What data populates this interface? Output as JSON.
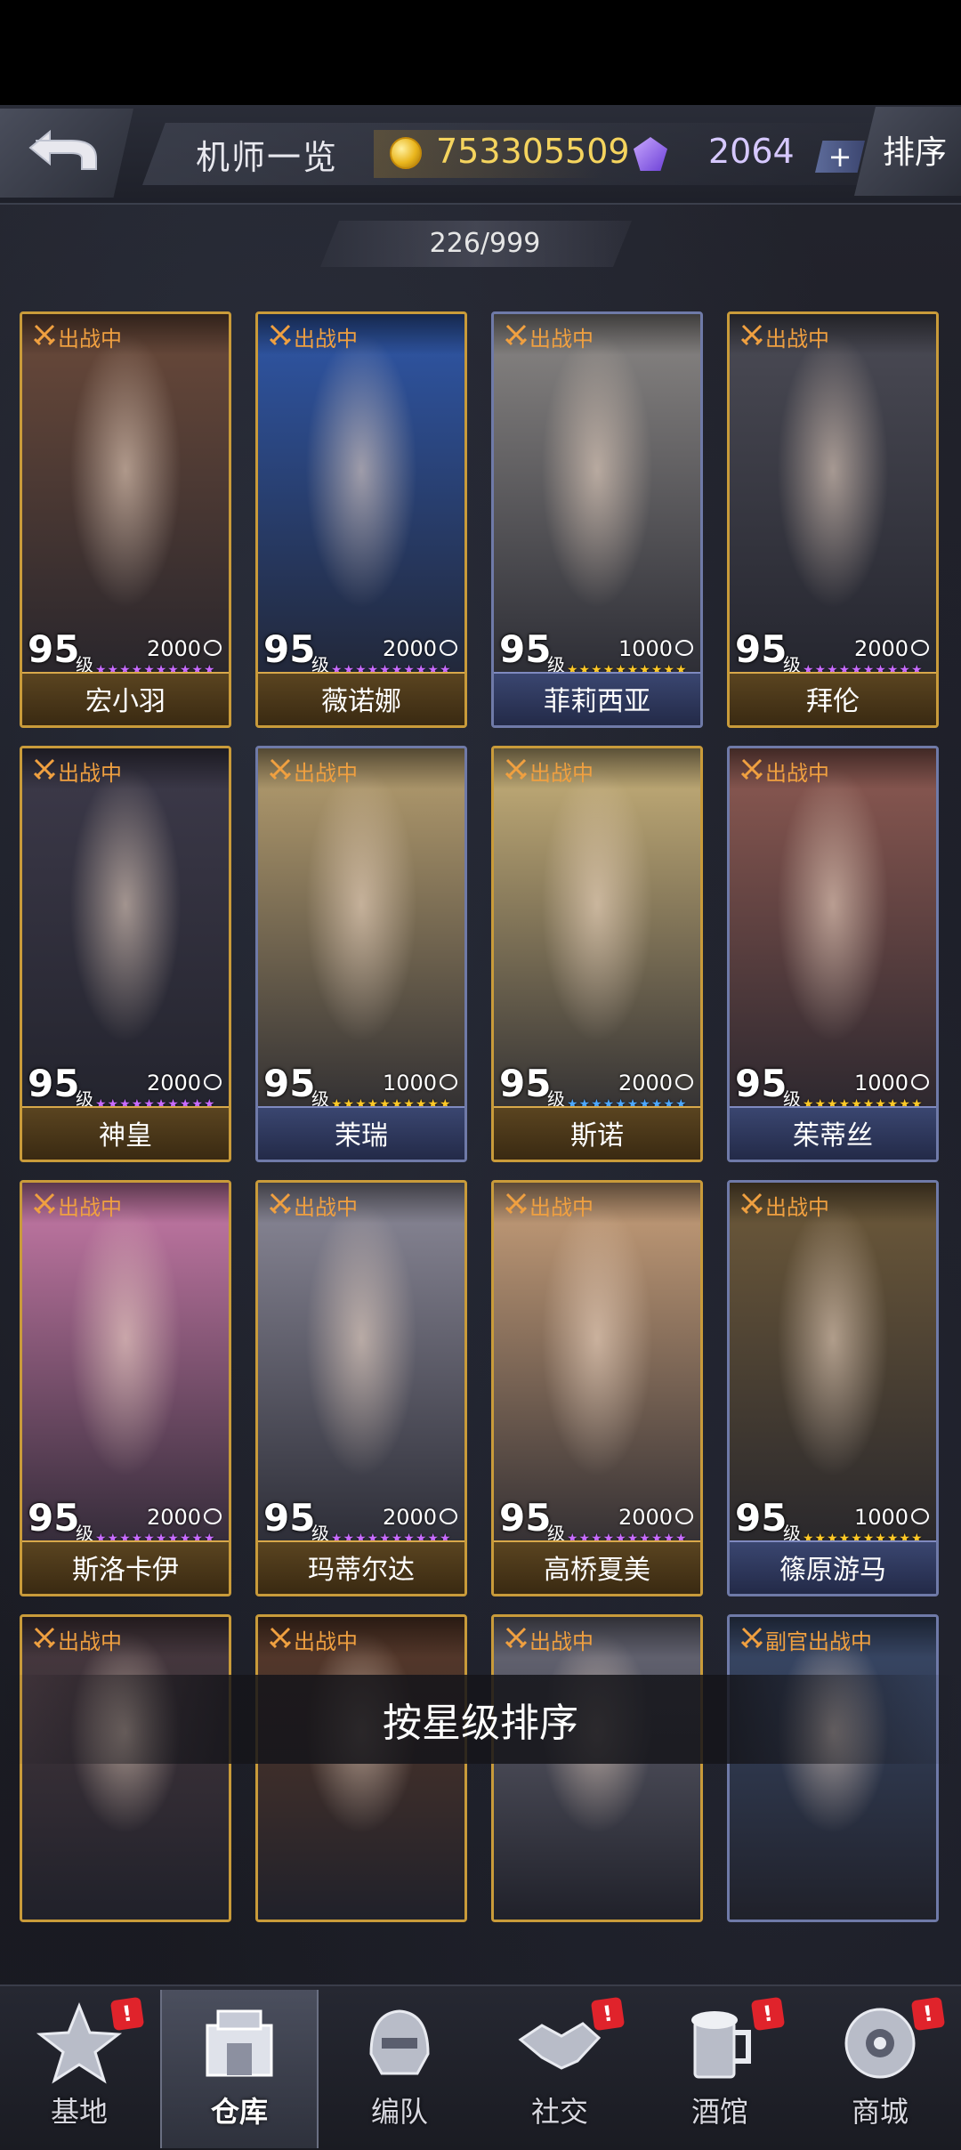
{
  "header": {
    "title": "机师一览",
    "gold": "753305509",
    "gems": "2064",
    "plus_label": "+",
    "sort_label": "排序"
  },
  "roster_count": "226/999",
  "cards": [
    {
      "status": "出战中",
      "level": "95",
      "level_unit": "级",
      "power": "2000",
      "stars": "★★★★★★★★★★",
      "star_color": "#c86cff",
      "name": "宏小羽",
      "frame": "gold",
      "art": "#6b4a3a"
    },
    {
      "status": "出战中",
      "level": "95",
      "level_unit": "级",
      "power": "2000",
      "stars": "★★★★★★★★★★",
      "star_color": "#c86cff",
      "name": "薇诺娜",
      "frame": "gold",
      "art": "#2f57a8"
    },
    {
      "status": "出战中",
      "level": "95",
      "level_unit": "级",
      "power": "1000",
      "stars": "★★★★★★★★★★",
      "star_color": "#ffc928",
      "name": "菲莉西亚",
      "frame": "blue",
      "art": "#8a8785"
    },
    {
      "status": "出战中",
      "level": "95",
      "level_unit": "级",
      "power": "2000",
      "stars": "★★★★★★★★★★",
      "star_color": "#c86cff",
      "name": "拜伦",
      "frame": "gold",
      "art": "#4b4b55"
    },
    {
      "status": "出战中",
      "level": "95",
      "level_unit": "级",
      "power": "2000",
      "stars": "★★★★★★★★★★",
      "star_color": "#c86cff",
      "name": "神皇",
      "frame": "gold",
      "art": "#3d3a4a"
    },
    {
      "status": "出战中",
      "level": "95",
      "level_unit": "级",
      "power": "1000",
      "stars": "★★★★★★★★★★",
      "star_color": "#ffc928",
      "name": "茉瑞",
      "frame": "blue",
      "art": "#b8a070"
    },
    {
      "status": "出战中",
      "level": "95",
      "level_unit": "级",
      "power": "2000",
      "stars": "★★★★★★★★★★",
      "star_color": "#4da8ff",
      "name": "斯诺",
      "frame": "gold",
      "art": "#c9b27a"
    },
    {
      "status": "出战中",
      "level": "95",
      "level_unit": "级",
      "power": "1000",
      "stars": "★★★★★★★★★★",
      "star_color": "#ffc928",
      "name": "茱蒂丝",
      "frame": "blue",
      "art": "#8e5a52"
    },
    {
      "status": "出战中",
      "level": "95",
      "level_unit": "级",
      "power": "2000",
      "stars": "★★★★★★★★★★",
      "star_color": "#c86cff",
      "name": "斯洛卡伊",
      "frame": "gold",
      "art": "#c87aa8"
    },
    {
      "status": "出战中",
      "level": "95",
      "level_unit": "级",
      "power": "2000",
      "stars": "★★★★★★★★★★",
      "star_color": "#c86cff",
      "name": "玛蒂尔达",
      "frame": "gold",
      "art": "#8c8a99"
    },
    {
      "status": "出战中",
      "level": "95",
      "level_unit": "级",
      "power": "2000",
      "stars": "★★★★★★★★★★",
      "star_color": "#c86cff",
      "name": "高桥夏美",
      "frame": "gold",
      "art": "#c9a07a"
    },
    {
      "status": "出战中",
      "level": "95",
      "level_unit": "级",
      "power": "1000",
      "stars": "★★★★★★★★★★",
      "star_color": "#ffc928",
      "name": "篠原游马",
      "frame": "blue",
      "art": "#6e5a3a"
    },
    {
      "status": "出战中",
      "level": "",
      "level_unit": "",
      "power": "",
      "stars": "",
      "star_color": "#c86cff",
      "name": "",
      "frame": "gold",
      "art": "#4a3a40"
    },
    {
      "status": "出战中",
      "level": "",
      "level_unit": "",
      "power": "",
      "stars": "",
      "star_color": "#c86cff",
      "name": "",
      "frame": "gold",
      "art": "#5a3a2a"
    },
    {
      "status": "出战中",
      "level": "",
      "level_unit": "",
      "power": "",
      "stars": "",
      "star_color": "#c86cff",
      "name": "",
      "frame": "gold",
      "art": "#6a6a78"
    },
    {
      "status": "副官出战中",
      "level": "",
      "level_unit": "",
      "power": "",
      "stars": "",
      "star_color": "#ffc928",
      "name": "",
      "frame": "blue",
      "art": "#3a4a6a"
    }
  ],
  "toast": "按星级排序",
  "nav": [
    {
      "label": "基地",
      "icon": "star-base-icon",
      "alert": "!",
      "active": false
    },
    {
      "label": "仓库",
      "icon": "warehouse-icon",
      "alert": "",
      "active": true
    },
    {
      "label": "编队",
      "icon": "helmet-icon",
      "alert": "",
      "active": false
    },
    {
      "label": "社交",
      "icon": "handshake-icon",
      "alert": "!",
      "active": false
    },
    {
      "label": "酒馆",
      "icon": "beer-mug-icon",
      "alert": "!",
      "active": false
    },
    {
      "label": "商城",
      "icon": "robot-head-icon",
      "alert": "!",
      "active": false
    }
  ]
}
